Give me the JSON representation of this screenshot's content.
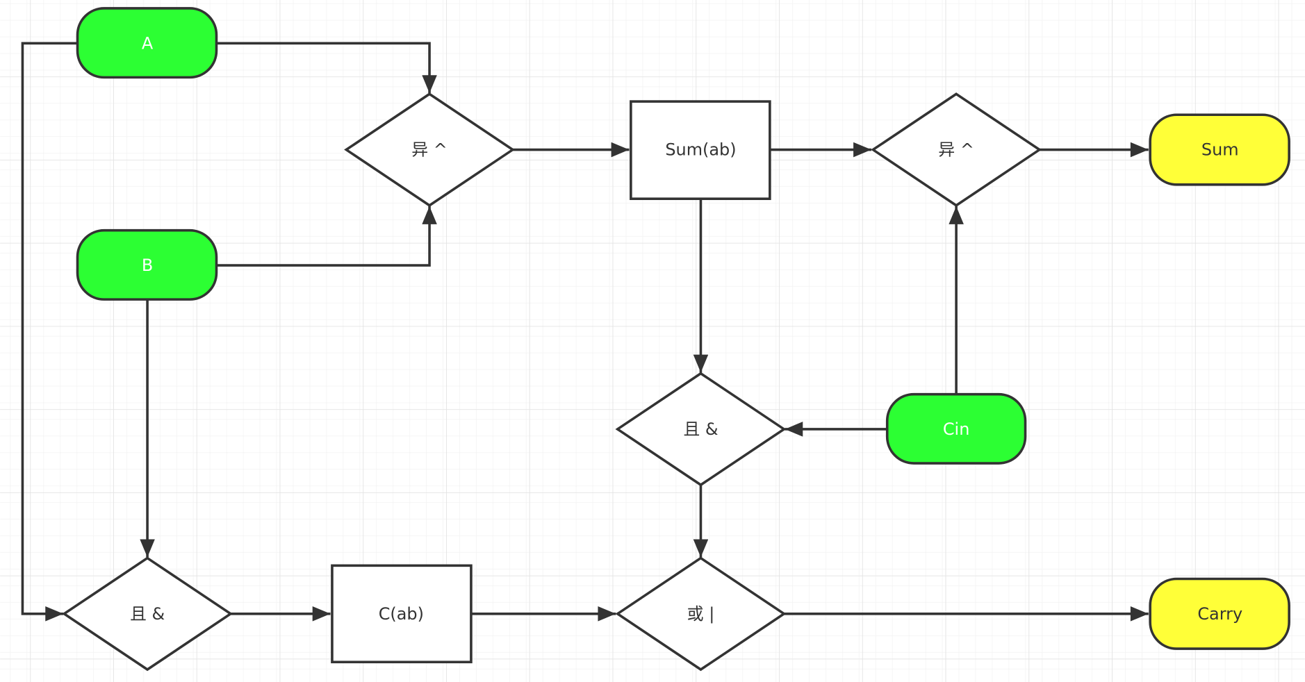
{
  "colors": {
    "input_fill": "#2cff33",
    "output_fill": "#ffff38",
    "stroke": "#333333",
    "grid_minor": "#f0f0f0",
    "grid_major": "#e3e3e3"
  },
  "nodes": {
    "a": "A",
    "b": "B",
    "cin": "Cin",
    "xor1": "异 ^",
    "sum_ab": "Sum(ab)",
    "xor2": "异 ^",
    "sum": "Sum",
    "and1": "且 &",
    "and2": "且 &",
    "c_ab": "C(ab)",
    "or": "或 |",
    "carry": "Carry"
  }
}
